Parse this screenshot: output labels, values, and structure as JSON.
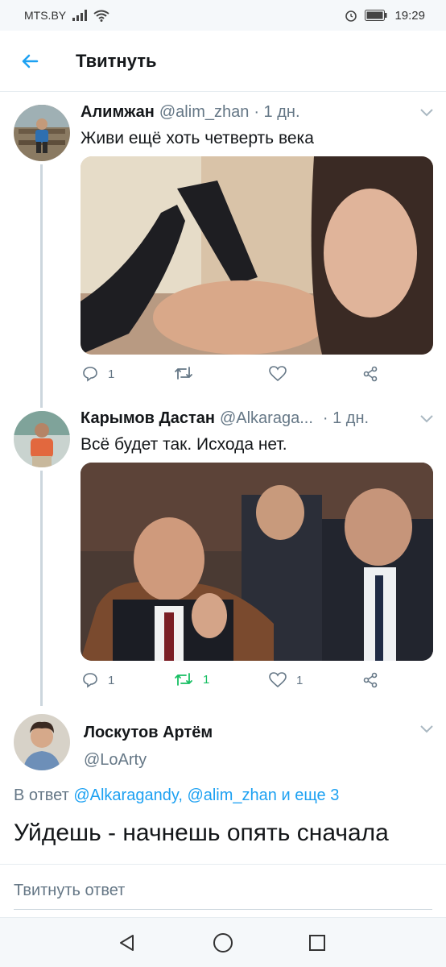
{
  "status_bar": {
    "carrier": "MTS.BY",
    "time": "19:29"
  },
  "app_bar": {
    "title": "Твитнуть",
    "back_icon": "arrow-left-icon"
  },
  "tweets": [
    {
      "name": "Алимжан",
      "handle": "@alim_zhan",
      "time": "· 1 дн.",
      "text": "Живи ещё хоть четверть века",
      "reply_count": "1",
      "retweet_count": "",
      "like_count": ""
    },
    {
      "name": "Карымов Дастан",
      "handle": "@Alkaraga...",
      "time": "· 1 дн.",
      "text": "Всё будет так. Исхода нет.",
      "reply_count": "1",
      "retweet_count": "1",
      "like_count": "1"
    }
  ],
  "focused_tweet": {
    "name": "Лоскутов Артём",
    "handle": "@LoArty",
    "reply_prefix": "В ответ",
    "reply_targets": "@Alkaragandy, @alim_zhan и еще 3",
    "text": "Уйдешь - начнешь опять сначала"
  },
  "compose": {
    "placeholder": "Твитнуть ответ"
  },
  "colors": {
    "accent": "#1da1f2",
    "retweet_green": "#17bf63",
    "muted": "#657786",
    "text": "#14171a"
  }
}
